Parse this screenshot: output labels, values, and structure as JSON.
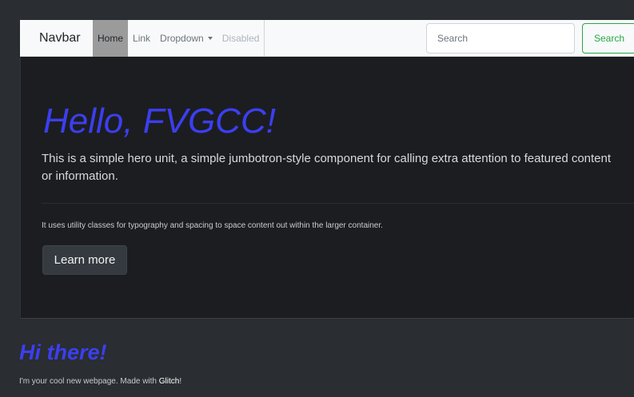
{
  "navbar": {
    "brand": "Navbar",
    "items": [
      {
        "label": "Home",
        "state": "active"
      },
      {
        "label": "Link",
        "state": "normal"
      },
      {
        "label": "Dropdown",
        "state": "normal",
        "icon": "caret-down-icon"
      },
      {
        "label": "Disabled",
        "state": "disabled"
      }
    ],
    "search": {
      "placeholder": "Search",
      "value": ""
    },
    "search_button": "Search"
  },
  "jumbotron": {
    "title": "Hello, FVGCC!",
    "lead": "This is a simple hero unit, a simple jumbotron-style component for calling extra attention to featured content or information.",
    "body": "It uses utility classes for typography and spacing to space content out within the larger container.",
    "button": "Learn more"
  },
  "footer": {
    "title": "Hi there!",
    "text_prefix": "I'm your cool new webpage. Made with ",
    "link": "Glitch",
    "text_suffix": "!"
  },
  "colors": {
    "heading": "#3b3ff0",
    "page_bg": "#2a2d31",
    "jumbotron_bg": "#1c1d21",
    "success": "#28a745"
  }
}
